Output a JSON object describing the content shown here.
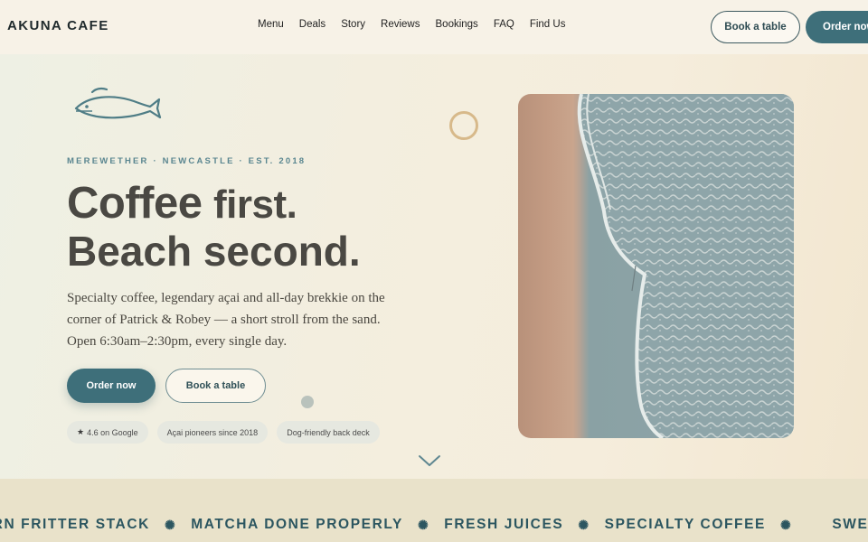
{
  "header": {
    "brand": "AKUNA CAFE",
    "nav": [
      "Menu",
      "Deals",
      "Story",
      "Reviews",
      "Bookings",
      "FAQ",
      "Find Us"
    ],
    "book_label": "Book a table",
    "order_label": "Order now"
  },
  "hero": {
    "eyebrow": "MEREWETHER · NEWCASTLE · EST. 2018",
    "headline_a": "Coffee",
    "headline_b": "first.",
    "headline_line2": "Beach second.",
    "lede": "Specialty coffee, legendary açai and all-day brekkie on the corner of Patrick & Robey — a short stroll from the sand. Open 6:30am–2:30pm, every single day.",
    "primary_cta": "Order now",
    "secondary_cta": "Book a table",
    "pills": [
      {
        "icon": "star-icon",
        "icon_glyph": "★",
        "label": "4.6 on Google"
      },
      {
        "label": "Açai pioneers since 2018"
      },
      {
        "label": "Dog-friendly back deck"
      }
    ]
  },
  "marquee": {
    "items": [
      "ORN FRITTER STACK",
      "MATCHA DONE PROPERLY",
      "FRESH JUICES",
      "SPECIALTY COFFEE",
      "SWEET AS BOWL"
    ],
    "separator": "✺"
  },
  "colors": {
    "accent": "#3e6f7a",
    "eyebrow": "#5a8690",
    "ring": "#d7b98a",
    "band": "#e9e2ca"
  },
  "icons": {
    "logo": "fish-icon",
    "scroll": "chevron-down-icon"
  }
}
